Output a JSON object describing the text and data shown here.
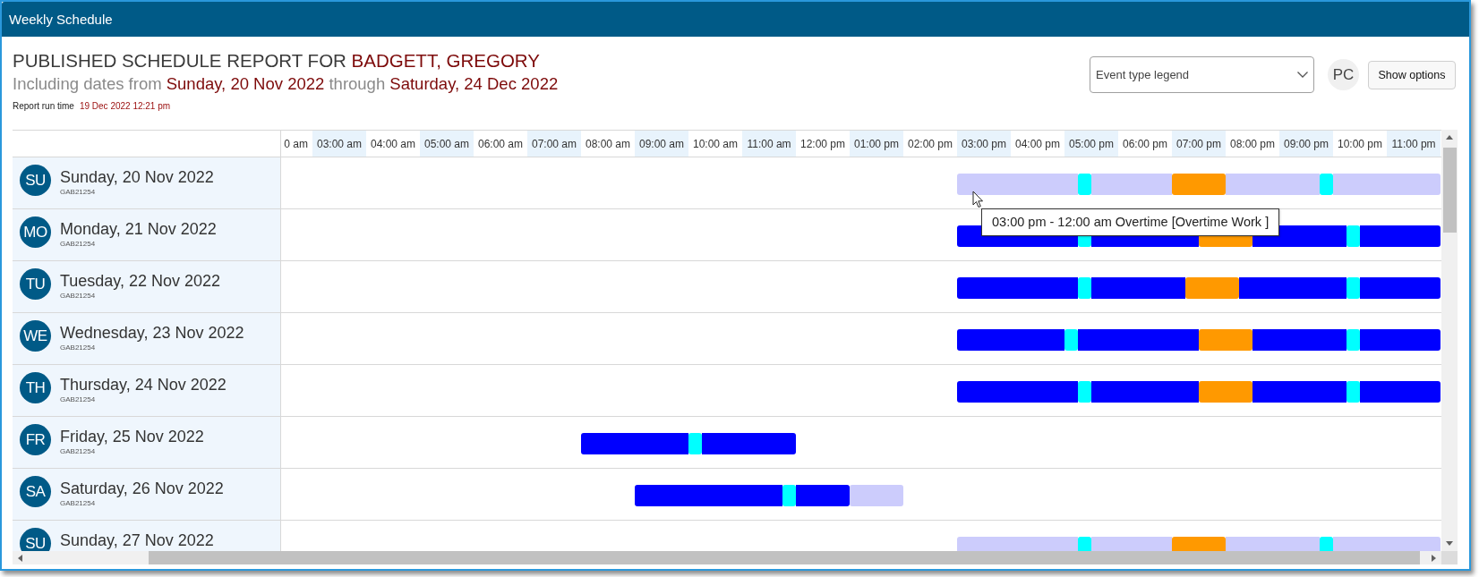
{
  "window": {
    "title": "Weekly Schedule"
  },
  "report": {
    "title": [
      {
        "text": "PUBLISHED SCHEDULE REPORT FOR",
        "kind": "plain"
      },
      {
        "text": "BADGETT, GREGORY",
        "kind": "highlight"
      }
    ],
    "subtitle": [
      {
        "text": "Including dates from",
        "kind": "plain"
      },
      {
        "text": "Sunday, 20 Nov 2022",
        "kind": "highlight"
      },
      {
        "text": "through",
        "kind": "plain"
      },
      {
        "text": "Saturday, 24 Dec 2022",
        "kind": "highlight"
      }
    ],
    "run_time": {
      "label": "Report run time",
      "value": "19 Dec 2022 12:21 pm"
    }
  },
  "toolbar": {
    "legend_dropdown": {
      "label": "Event type legend"
    },
    "avatar": {
      "initials": "PC"
    },
    "options_button": {
      "label": "Show options"
    }
  },
  "timeline": {
    "hours": [
      "0 am",
      "03:00 am",
      "04:00 am",
      "05:00 am",
      "06:00 am",
      "07:00 am",
      "08:00 am",
      "09:00 am",
      "10:00 am",
      "11:00 am",
      "12:00 pm",
      "01:00 pm",
      "02:00 pm",
      "03:00 pm",
      "04:00 pm",
      "05:00 pm",
      "06:00 pm",
      "07:00 pm",
      "08:00 pm",
      "09:00 pm",
      "10:00 pm",
      "11:00 pm"
    ]
  },
  "days": [
    {
      "abbr": "SU",
      "date": "Sunday, 20 Nov 2022",
      "code": "GAB21254",
      "blocks": [
        {
          "color": "#ccccfc"
        },
        {
          "color": "#00ffff"
        },
        {
          "color": "#ff9900"
        },
        {
          "color": "#00ffff"
        }
      ]
    },
    {
      "abbr": "MO",
      "date": "Monday, 21 Nov 2022",
      "code": "GAB21254",
      "blocks": [
        {
          "color": "#0000ff"
        },
        {
          "color": "#00ffff"
        },
        {
          "color": "#ff9900"
        },
        {
          "color": "#00ffff"
        }
      ]
    },
    {
      "abbr": "TU",
      "date": "Tuesday, 22 Nov 2022",
      "code": "GAB21254",
      "blocks": [
        {
          "color": "#0000ff"
        },
        {
          "color": "#00ffff"
        },
        {
          "color": "#ff9900"
        },
        {
          "color": "#00ffff"
        }
      ]
    },
    {
      "abbr": "WE",
      "date": "Wednesday, 23 Nov 2022",
      "code": "GAB21254",
      "blocks": [
        {
          "color": "#0000ff"
        },
        {
          "color": "#00ffff"
        },
        {
          "color": "#ff9900"
        },
        {
          "color": "#00ffff"
        }
      ]
    },
    {
      "abbr": "TH",
      "date": "Thursday, 24 Nov 2022",
      "code": "GAB21254",
      "blocks": [
        {
          "color": "#0000ff"
        },
        {
          "color": "#00ffff"
        },
        {
          "color": "#ff9900"
        },
        {
          "color": "#00ffff"
        }
      ]
    },
    {
      "abbr": "FR",
      "date": "Friday, 25 Nov 2022",
      "code": "GAB21254",
      "blocks": [
        {
          "color": "#0000ff"
        },
        {
          "color": "#00ffff"
        }
      ]
    },
    {
      "abbr": "SA",
      "date": "Saturday, 26 Nov 2022",
      "code": "GAB21254",
      "blocks": [
        {
          "color": "#0000ff"
        },
        {
          "color": "#00ffff"
        },
        {
          "color": "#ccccfc"
        }
      ]
    },
    {
      "abbr": "SU",
      "date": "Sunday, 27 Nov 2022",
      "blocks": [
        {
          "color": "#ccccfc"
        },
        {
          "color": "#00ffff"
        },
        {
          "color": "#ff9900"
        },
        {
          "color": "#00ffff"
        }
      ]
    }
  ],
  "tooltip": {
    "text": "03:00 pm - 12:00 am Overtime [Overtime Work ]"
  }
}
